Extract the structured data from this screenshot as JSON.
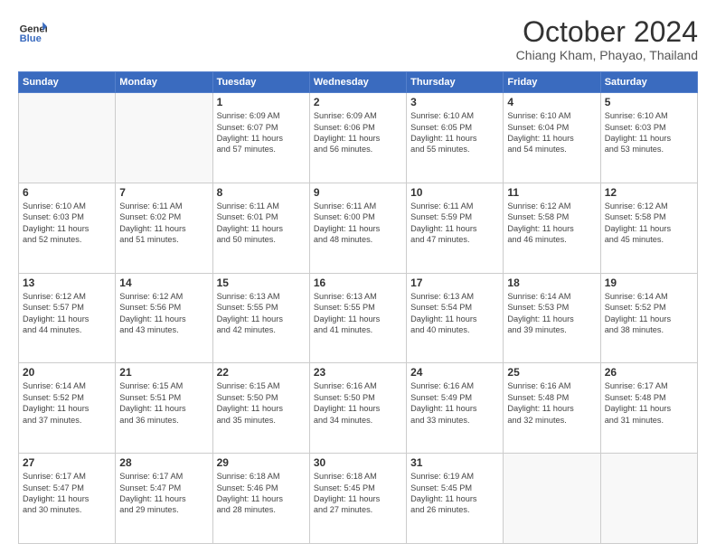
{
  "header": {
    "logo_line1": "General",
    "logo_line2": "Blue",
    "month": "October 2024",
    "location": "Chiang Kham, Phayao, Thailand"
  },
  "weekdays": [
    "Sunday",
    "Monday",
    "Tuesday",
    "Wednesday",
    "Thursday",
    "Friday",
    "Saturday"
  ],
  "weeks": [
    [
      {
        "day": "",
        "info": ""
      },
      {
        "day": "",
        "info": ""
      },
      {
        "day": "1",
        "info": "Sunrise: 6:09 AM\nSunset: 6:07 PM\nDaylight: 11 hours\nand 57 minutes."
      },
      {
        "day": "2",
        "info": "Sunrise: 6:09 AM\nSunset: 6:06 PM\nDaylight: 11 hours\nand 56 minutes."
      },
      {
        "day": "3",
        "info": "Sunrise: 6:10 AM\nSunset: 6:05 PM\nDaylight: 11 hours\nand 55 minutes."
      },
      {
        "day": "4",
        "info": "Sunrise: 6:10 AM\nSunset: 6:04 PM\nDaylight: 11 hours\nand 54 minutes."
      },
      {
        "day": "5",
        "info": "Sunrise: 6:10 AM\nSunset: 6:03 PM\nDaylight: 11 hours\nand 53 minutes."
      }
    ],
    [
      {
        "day": "6",
        "info": "Sunrise: 6:10 AM\nSunset: 6:03 PM\nDaylight: 11 hours\nand 52 minutes."
      },
      {
        "day": "7",
        "info": "Sunrise: 6:11 AM\nSunset: 6:02 PM\nDaylight: 11 hours\nand 51 minutes."
      },
      {
        "day": "8",
        "info": "Sunrise: 6:11 AM\nSunset: 6:01 PM\nDaylight: 11 hours\nand 50 minutes."
      },
      {
        "day": "9",
        "info": "Sunrise: 6:11 AM\nSunset: 6:00 PM\nDaylight: 11 hours\nand 48 minutes."
      },
      {
        "day": "10",
        "info": "Sunrise: 6:11 AM\nSunset: 5:59 PM\nDaylight: 11 hours\nand 47 minutes."
      },
      {
        "day": "11",
        "info": "Sunrise: 6:12 AM\nSunset: 5:58 PM\nDaylight: 11 hours\nand 46 minutes."
      },
      {
        "day": "12",
        "info": "Sunrise: 6:12 AM\nSunset: 5:58 PM\nDaylight: 11 hours\nand 45 minutes."
      }
    ],
    [
      {
        "day": "13",
        "info": "Sunrise: 6:12 AM\nSunset: 5:57 PM\nDaylight: 11 hours\nand 44 minutes."
      },
      {
        "day": "14",
        "info": "Sunrise: 6:12 AM\nSunset: 5:56 PM\nDaylight: 11 hours\nand 43 minutes."
      },
      {
        "day": "15",
        "info": "Sunrise: 6:13 AM\nSunset: 5:55 PM\nDaylight: 11 hours\nand 42 minutes."
      },
      {
        "day": "16",
        "info": "Sunrise: 6:13 AM\nSunset: 5:55 PM\nDaylight: 11 hours\nand 41 minutes."
      },
      {
        "day": "17",
        "info": "Sunrise: 6:13 AM\nSunset: 5:54 PM\nDaylight: 11 hours\nand 40 minutes."
      },
      {
        "day": "18",
        "info": "Sunrise: 6:14 AM\nSunset: 5:53 PM\nDaylight: 11 hours\nand 39 minutes."
      },
      {
        "day": "19",
        "info": "Sunrise: 6:14 AM\nSunset: 5:52 PM\nDaylight: 11 hours\nand 38 minutes."
      }
    ],
    [
      {
        "day": "20",
        "info": "Sunrise: 6:14 AM\nSunset: 5:52 PM\nDaylight: 11 hours\nand 37 minutes."
      },
      {
        "day": "21",
        "info": "Sunrise: 6:15 AM\nSunset: 5:51 PM\nDaylight: 11 hours\nand 36 minutes."
      },
      {
        "day": "22",
        "info": "Sunrise: 6:15 AM\nSunset: 5:50 PM\nDaylight: 11 hours\nand 35 minutes."
      },
      {
        "day": "23",
        "info": "Sunrise: 6:16 AM\nSunset: 5:50 PM\nDaylight: 11 hours\nand 34 minutes."
      },
      {
        "day": "24",
        "info": "Sunrise: 6:16 AM\nSunset: 5:49 PM\nDaylight: 11 hours\nand 33 minutes."
      },
      {
        "day": "25",
        "info": "Sunrise: 6:16 AM\nSunset: 5:48 PM\nDaylight: 11 hours\nand 32 minutes."
      },
      {
        "day": "26",
        "info": "Sunrise: 6:17 AM\nSunset: 5:48 PM\nDaylight: 11 hours\nand 31 minutes."
      }
    ],
    [
      {
        "day": "27",
        "info": "Sunrise: 6:17 AM\nSunset: 5:47 PM\nDaylight: 11 hours\nand 30 minutes."
      },
      {
        "day": "28",
        "info": "Sunrise: 6:17 AM\nSunset: 5:47 PM\nDaylight: 11 hours\nand 29 minutes."
      },
      {
        "day": "29",
        "info": "Sunrise: 6:18 AM\nSunset: 5:46 PM\nDaylight: 11 hours\nand 28 minutes."
      },
      {
        "day": "30",
        "info": "Sunrise: 6:18 AM\nSunset: 5:45 PM\nDaylight: 11 hours\nand 27 minutes."
      },
      {
        "day": "31",
        "info": "Sunrise: 6:19 AM\nSunset: 5:45 PM\nDaylight: 11 hours\nand 26 minutes."
      },
      {
        "day": "",
        "info": ""
      },
      {
        "day": "",
        "info": ""
      }
    ]
  ]
}
